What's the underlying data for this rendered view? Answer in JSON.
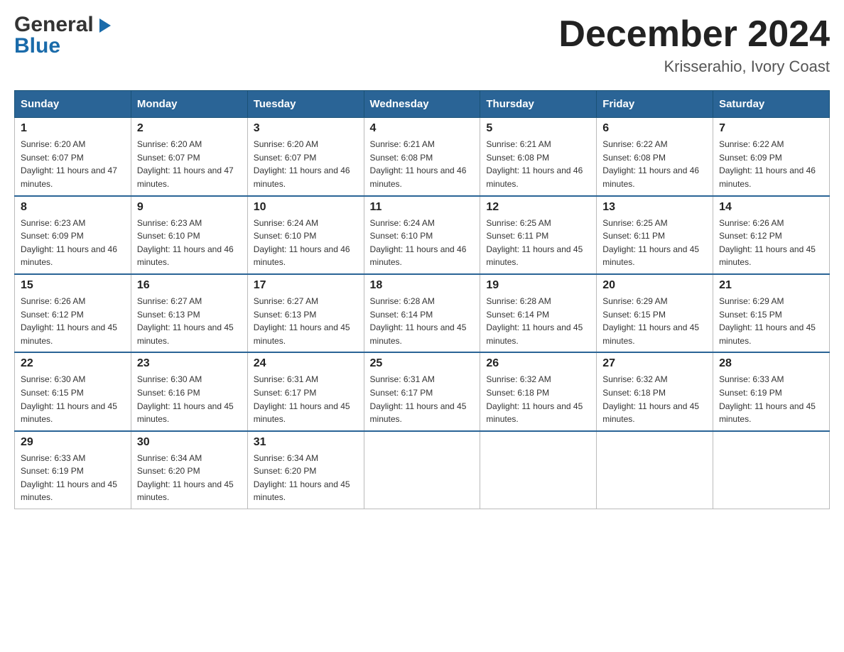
{
  "header": {
    "logo_line1": "General",
    "logo_line2": "Blue",
    "title": "December 2024",
    "location": "Krisserahio, Ivory Coast"
  },
  "days_of_week": [
    "Sunday",
    "Monday",
    "Tuesday",
    "Wednesday",
    "Thursday",
    "Friday",
    "Saturday"
  ],
  "weeks": [
    [
      {
        "day": "1",
        "sunrise": "6:20 AM",
        "sunset": "6:07 PM",
        "daylight": "11 hours and 47 minutes."
      },
      {
        "day": "2",
        "sunrise": "6:20 AM",
        "sunset": "6:07 PM",
        "daylight": "11 hours and 47 minutes."
      },
      {
        "day": "3",
        "sunrise": "6:20 AM",
        "sunset": "6:07 PM",
        "daylight": "11 hours and 46 minutes."
      },
      {
        "day": "4",
        "sunrise": "6:21 AM",
        "sunset": "6:08 PM",
        "daylight": "11 hours and 46 minutes."
      },
      {
        "day": "5",
        "sunrise": "6:21 AM",
        "sunset": "6:08 PM",
        "daylight": "11 hours and 46 minutes."
      },
      {
        "day": "6",
        "sunrise": "6:22 AM",
        "sunset": "6:08 PM",
        "daylight": "11 hours and 46 minutes."
      },
      {
        "day": "7",
        "sunrise": "6:22 AM",
        "sunset": "6:09 PM",
        "daylight": "11 hours and 46 minutes."
      }
    ],
    [
      {
        "day": "8",
        "sunrise": "6:23 AM",
        "sunset": "6:09 PM",
        "daylight": "11 hours and 46 minutes."
      },
      {
        "day": "9",
        "sunrise": "6:23 AM",
        "sunset": "6:10 PM",
        "daylight": "11 hours and 46 minutes."
      },
      {
        "day": "10",
        "sunrise": "6:24 AM",
        "sunset": "6:10 PM",
        "daylight": "11 hours and 46 minutes."
      },
      {
        "day": "11",
        "sunrise": "6:24 AM",
        "sunset": "6:10 PM",
        "daylight": "11 hours and 46 minutes."
      },
      {
        "day": "12",
        "sunrise": "6:25 AM",
        "sunset": "6:11 PM",
        "daylight": "11 hours and 45 minutes."
      },
      {
        "day": "13",
        "sunrise": "6:25 AM",
        "sunset": "6:11 PM",
        "daylight": "11 hours and 45 minutes."
      },
      {
        "day": "14",
        "sunrise": "6:26 AM",
        "sunset": "6:12 PM",
        "daylight": "11 hours and 45 minutes."
      }
    ],
    [
      {
        "day": "15",
        "sunrise": "6:26 AM",
        "sunset": "6:12 PM",
        "daylight": "11 hours and 45 minutes."
      },
      {
        "day": "16",
        "sunrise": "6:27 AM",
        "sunset": "6:13 PM",
        "daylight": "11 hours and 45 minutes."
      },
      {
        "day": "17",
        "sunrise": "6:27 AM",
        "sunset": "6:13 PM",
        "daylight": "11 hours and 45 minutes."
      },
      {
        "day": "18",
        "sunrise": "6:28 AM",
        "sunset": "6:14 PM",
        "daylight": "11 hours and 45 minutes."
      },
      {
        "day": "19",
        "sunrise": "6:28 AM",
        "sunset": "6:14 PM",
        "daylight": "11 hours and 45 minutes."
      },
      {
        "day": "20",
        "sunrise": "6:29 AM",
        "sunset": "6:15 PM",
        "daylight": "11 hours and 45 minutes."
      },
      {
        "day": "21",
        "sunrise": "6:29 AM",
        "sunset": "6:15 PM",
        "daylight": "11 hours and 45 minutes."
      }
    ],
    [
      {
        "day": "22",
        "sunrise": "6:30 AM",
        "sunset": "6:15 PM",
        "daylight": "11 hours and 45 minutes."
      },
      {
        "day": "23",
        "sunrise": "6:30 AM",
        "sunset": "6:16 PM",
        "daylight": "11 hours and 45 minutes."
      },
      {
        "day": "24",
        "sunrise": "6:31 AM",
        "sunset": "6:17 PM",
        "daylight": "11 hours and 45 minutes."
      },
      {
        "day": "25",
        "sunrise": "6:31 AM",
        "sunset": "6:17 PM",
        "daylight": "11 hours and 45 minutes."
      },
      {
        "day": "26",
        "sunrise": "6:32 AM",
        "sunset": "6:18 PM",
        "daylight": "11 hours and 45 minutes."
      },
      {
        "day": "27",
        "sunrise": "6:32 AM",
        "sunset": "6:18 PM",
        "daylight": "11 hours and 45 minutes."
      },
      {
        "day": "28",
        "sunrise": "6:33 AM",
        "sunset": "6:19 PM",
        "daylight": "11 hours and 45 minutes."
      }
    ],
    [
      {
        "day": "29",
        "sunrise": "6:33 AM",
        "sunset": "6:19 PM",
        "daylight": "11 hours and 45 minutes."
      },
      {
        "day": "30",
        "sunrise": "6:34 AM",
        "sunset": "6:20 PM",
        "daylight": "11 hours and 45 minutes."
      },
      {
        "day": "31",
        "sunrise": "6:34 AM",
        "sunset": "6:20 PM",
        "daylight": "11 hours and 45 minutes."
      },
      null,
      null,
      null,
      null
    ]
  ]
}
